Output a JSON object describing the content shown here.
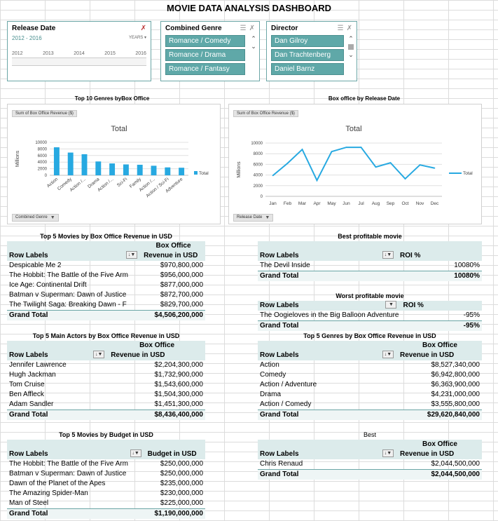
{
  "page": {
    "title": "MOVIE  DATA ANALYSIS DASHBOARD"
  },
  "slicers": {
    "release_date": {
      "title": "Release Date",
      "range": "2012 - 2016",
      "level": "YEARS",
      "years": [
        "2012",
        "2013",
        "2014",
        "2015",
        "2016"
      ]
    },
    "genre": {
      "title": "Combined Genre",
      "items": [
        "Romance / Comedy",
        "Romance / Drama",
        "Romance / Fantasy"
      ]
    },
    "director": {
      "title": "Director",
      "items": [
        "Dan Gilroy",
        "Dan Trachtenberg",
        "Daniel Barnz"
      ]
    }
  },
  "chart_genres": {
    "title": "Top 10 Genres byBox Office",
    "field_label": "Sum of Box Office Revenue ($)",
    "axis_field": "Combined Genre",
    "chart_data": {
      "type": "bar",
      "title": "Total",
      "ylabel": "Millions",
      "ylim": [
        0,
        10000
      ],
      "yticks": [
        "0",
        "2000",
        "4000",
        "6000",
        "8000",
        "10000"
      ],
      "categories": [
        "Action",
        "Comedy",
        "Action /...",
        "Drama",
        "Action /...",
        "Sci-Fi",
        "Family",
        "Action /...",
        "Action / Sci-Fi",
        "Adventure"
      ],
      "series": [
        {
          "name": "Total",
          "values": [
            8500,
            6900,
            6400,
            4200,
            3600,
            3300,
            3200,
            2900,
            2400,
            2300
          ]
        }
      ],
      "legend": "right",
      "color": "#27a9e1"
    }
  },
  "chart_release": {
    "title": "Box office by Release Date",
    "field_label": "Sum of Box Office Revenue ($)",
    "axis_field": "Release Date",
    "chart_data": {
      "type": "line",
      "title": "Total",
      "ylabel": "Millions",
      "ylim": [
        0,
        10000
      ],
      "yticks": [
        "0",
        "2000",
        "4000",
        "6000",
        "8000",
        "10000"
      ],
      "categories": [
        "Jan",
        "Feb",
        "Mar",
        "Apr",
        "May",
        "Jun",
        "Jul",
        "Aug",
        "Sep",
        "Oct",
        "Nov",
        "Dec"
      ],
      "series": [
        {
          "name": "Total",
          "values": [
            3900,
            6200,
            8800,
            3000,
            8400,
            9200,
            9200,
            5500,
            6300,
            3300,
            5900,
            5300
          ]
        }
      ],
      "legend": "right",
      "color": "#27a9e1"
    }
  },
  "pivots": {
    "top_movies": {
      "title": "Top 5 Movies by Box Office Revenue in USD",
      "row_label": "Row Labels",
      "value_header_1": "Box Office",
      "value_header_2": "Revenue in USD",
      "rows": [
        {
          "label": "Despicable Me 2",
          "value": "$970,800,000"
        },
        {
          "label": "The Hobbit: The Battle of the Five Arm",
          "value": "$956,000,000"
        },
        {
          "label": "Ice Age: Continental Drift",
          "value": "$877,000,000"
        },
        {
          "label": "Batman v Superman: Dawn of Justice",
          "value": "$872,700,000"
        },
        {
          "label": "The Twilight Saga: Breaking Dawn - F",
          "value": "$829,700,000"
        }
      ],
      "total_label": "Grand Total",
      "total_value": "$4,506,200,000"
    },
    "best_movie": {
      "title": "Best profitable movie",
      "row_label": "Row Labels",
      "value_header": "ROI %",
      "rows": [
        {
          "label": "The Devil Inside",
          "value": "10080%"
        }
      ],
      "total_label": "Grand Total",
      "total_value": "10080%"
    },
    "worst_movie": {
      "title": "Worst profitable movie",
      "row_label": "Row Labels",
      "value_header": "ROI %",
      "rows": [
        {
          "label": "The Oogieloves in the Big Balloon Adventure",
          "value": "-95%"
        }
      ],
      "total_label": "Grand Total",
      "total_value": "-95%"
    },
    "top_actors": {
      "title": "Top 5 Main Actors by Box Office Revenue in USD",
      "row_label": "Row Labels",
      "value_header_1": "Box Office",
      "value_header_2": "Revenue in USD",
      "rows": [
        {
          "label": "Jennifer Lawrence",
          "value": "$2,204,300,000"
        },
        {
          "label": "Hugh Jackman",
          "value": "$1,732,900,000"
        },
        {
          "label": "Tom Cruise",
          "value": "$1,543,600,000"
        },
        {
          "label": "Ben Affleck",
          "value": "$1,504,300,000"
        },
        {
          "label": "Adam Sandler",
          "value": "$1,451,300,000"
        }
      ],
      "total_label": "Grand Total",
      "total_value": "$8,436,400,000"
    },
    "top_genres": {
      "title": "Top 5 Genres by Box Office Revenue in USD",
      "row_label": "Row Labels",
      "value_header_1": "Box Office",
      "value_header_2": "Revenue in USD",
      "rows": [
        {
          "label": "Action",
          "value": "$8,527,340,000"
        },
        {
          "label": "Comedy",
          "value": "$6,942,800,000"
        },
        {
          "label": "Action / Adventure",
          "value": "$6,363,900,000"
        },
        {
          "label": "Drama",
          "value": "$4,231,000,000"
        },
        {
          "label": "Action / Comedy",
          "value": "$3,555,800,000"
        }
      ],
      "total_label": "Grand Total",
      "total_value": "$29,620,840,000"
    },
    "top_budget": {
      "title": "Top 5 Movies by Budget in USD",
      "row_label": "Row Labels",
      "value_header": "Budget in USD",
      "rows": [
        {
          "label": "The Hobbit: The Battle of the Five Arm",
          "value": "$250,000,000"
        },
        {
          "label": "Batman v Superman: Dawn of Justice",
          "value": "$250,000,000"
        },
        {
          "label": "Dawn of the Planet of the Apes",
          "value": "$235,000,000"
        },
        {
          "label": "The Amazing Spider-Man",
          "value": "$230,000,000"
        },
        {
          "label": "Man of Steel",
          "value": "$225,000,000"
        }
      ],
      "total_label": "Grand Total",
      "total_value": "$1,190,000,000"
    },
    "best_director": {
      "title": "Best",
      "row_label": "Row Labels",
      "value_header_1": "Box Office",
      "value_header_2": "Revenue in USD",
      "rows": [
        {
          "label": "Chris Renaud",
          "value": "$2,044,500,000"
        }
      ],
      "total_label": "Grand Total",
      "total_value": "$2,044,500,000"
    }
  }
}
